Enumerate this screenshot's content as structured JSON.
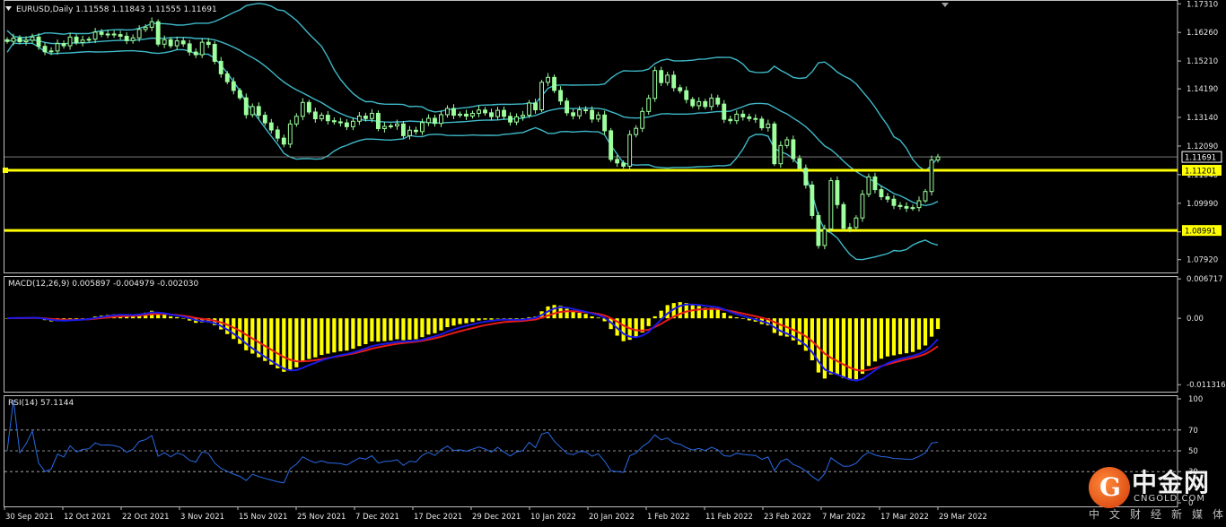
{
  "chart_data": {
    "type": "candlestick",
    "header": "EURUSD,Daily  1.11558 1.11843 1.11555 1.11691",
    "colors": {
      "background": "#000000",
      "bull": "#9dff9d",
      "bear": "#9dff9d",
      "bollinger": "#3fb8c8",
      "support": "#ffff00",
      "histogram": "#ffff00",
      "macd": "#1a1ae6",
      "signal": "#e61a1a",
      "rsi": "#2a6ae6",
      "frame": "#c0c0c0",
      "text": "#e6e6e6"
    },
    "price_axis": {
      "range": [
        1.0745,
        1.1745
      ],
      "ticks": [
        "1.17310",
        "1.16260",
        "1.15210",
        "1.14190",
        "1.13140",
        "1.12090",
        "1.11040",
        "1.09990",
        "1.08940",
        "1.07920"
      ],
      "current_price": "1.11691",
      "level_labels": [
        "1.11201",
        "1.08991"
      ]
    },
    "support_lines": [
      1.11201,
      1.08991
    ],
    "date_labels": [
      "30 Sep 2021",
      "12 Oct 2021",
      "22 Oct 2021",
      "3 Nov 2021",
      "15 Nov 2021",
      "25 Nov 2021",
      "7 Dec 2021",
      "17 Dec 2021",
      "29 Dec 2021",
      "10 Jan 2022",
      "20 Jan 2022",
      "1 Feb 2022",
      "11 Feb 2022",
      "23 Feb 2022",
      "7 Mar 2022",
      "17 Mar 2022",
      "29 Mar 2022"
    ],
    "closes": [
      1.1593,
      1.1605,
      1.1592,
      1.1597,
      1.1609,
      1.1575,
      1.1555,
      1.1558,
      1.1585,
      1.1577,
      1.1609,
      1.1589,
      1.1598,
      1.1601,
      1.1627,
      1.1619,
      1.162,
      1.1618,
      1.1612,
      1.1596,
      1.1606,
      1.1637,
      1.1645,
      1.1665,
      1.1583,
      1.1599,
      1.1577,
      1.1595,
      1.1584,
      1.1554,
      1.1544,
      1.159,
      1.1582,
      1.152,
      1.1474,
      1.1445,
      1.1413,
      1.1386,
      1.1324,
      1.1354,
      1.1322,
      1.1294,
      1.1268,
      1.1238,
      1.1216,
      1.129,
      1.1318,
      1.1369,
      1.1334,
      1.1309,
      1.1322,
      1.1302,
      1.1298,
      1.1294,
      1.128,
      1.13,
      1.1319,
      1.131,
      1.1329,
      1.1273,
      1.1281,
      1.1283,
      1.129,
      1.1247,
      1.1267,
      1.1262,
      1.1295,
      1.1311,
      1.1292,
      1.1324,
      1.1347,
      1.1322,
      1.1326,
      1.1319,
      1.1329,
      1.1341,
      1.1331,
      1.1317,
      1.134,
      1.1318,
      1.1297,
      1.1316,
      1.1322,
      1.1367,
      1.1342,
      1.1443,
      1.1461,
      1.1413,
      1.1374,
      1.1331,
      1.132,
      1.1342,
      1.134,
      1.1308,
      1.1323,
      1.1265,
      1.116,
      1.1147,
      1.1135,
      1.1251,
      1.1274,
      1.1336,
      1.1384,
      1.1486,
      1.1442,
      1.1469,
      1.1423,
      1.1412,
      1.138,
      1.1357,
      1.1372,
      1.1354,
      1.1385,
      1.1363,
      1.1307,
      1.1302,
      1.1326,
      1.1316,
      1.131,
      1.1308,
      1.1276,
      1.129,
      1.1144,
      1.1211,
      1.1232,
      1.1163,
      1.1127,
      1.1066,
      1.0954,
      1.0844,
      1.0905,
      1.1082,
      1.0994,
      1.0907,
      1.091,
      1.0945,
      1.1032,
      1.1096,
      1.1049,
      1.1023,
      1.1014,
      1.0991,
      1.0987,
      1.0981,
      1.0983,
      1.1008,
      1.1042,
      1.1158,
      1.1169
    ],
    "macd": {
      "label": "MACD(12,26,9) 0.005897 -0.004979 -0.002030",
      "range": [
        -0.0125,
        0.0072
      ],
      "ticks": [
        "0.006717",
        "0.00",
        "-0.011316"
      ],
      "histogram_hint": "main line (shown as bars) vs signal"
    },
    "rsi": {
      "label": "RSI(14) 57.1144",
      "period": 14,
      "ticks": [
        "100",
        "70",
        "50",
        "30",
        "0"
      ],
      "levels": [
        70,
        50,
        30
      ]
    }
  },
  "watermark": {
    "logo_glyph": "G",
    "name": "中金网",
    "domain": "CNGOLD.COM",
    "tagline": "中文财经新媒体"
  }
}
